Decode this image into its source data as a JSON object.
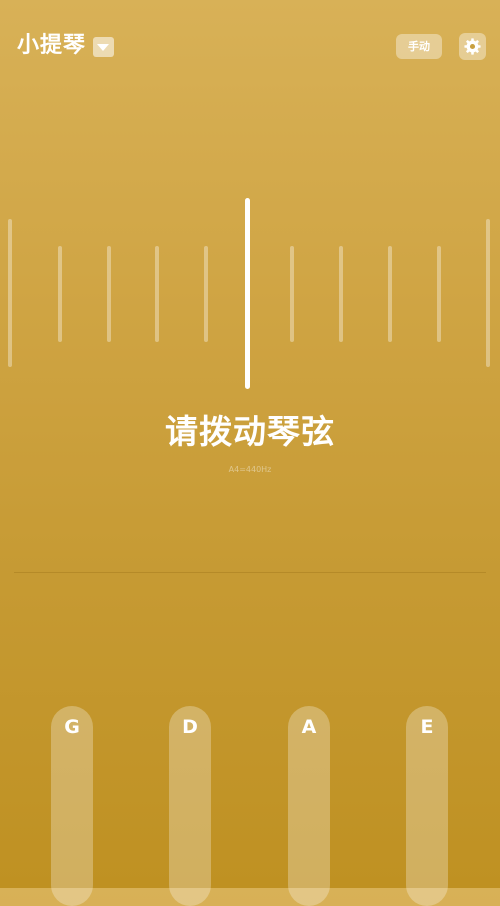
{
  "header": {
    "instrument": "小提琴",
    "mode_label": "手动"
  },
  "tuner": {
    "status": "请拨动琴弦",
    "reference": "A4=440Hz"
  },
  "strings": [
    {
      "note": "G"
    },
    {
      "note": "D"
    },
    {
      "note": "A"
    },
    {
      "note": "E"
    }
  ],
  "icons": {
    "dropdown": "chevron-down-icon",
    "settings": "settings-icon"
  },
  "colors": {
    "background_top": "#d8b157",
    "background_bottom": "#bf9122",
    "needle": "#ffffff"
  }
}
